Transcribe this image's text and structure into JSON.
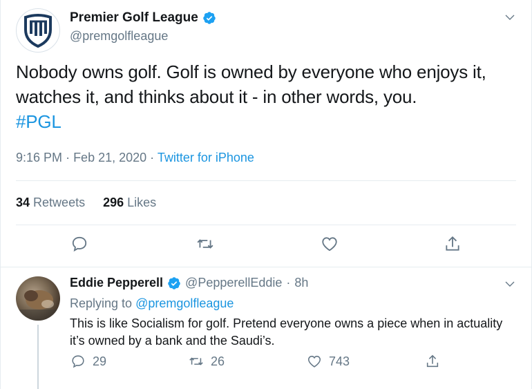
{
  "main_tweet": {
    "display_name": "Premier Golf League",
    "handle": "@premgolfleague",
    "text": "Nobody owns golf. Golf is owned by everyone who enjoys it, watches it, and thinks about it - in other words, you.",
    "hashtag": "#PGL",
    "time": "9:16 PM",
    "date": "Feb 21, 2020",
    "source": "Twitter for iPhone",
    "retweets_count": "34",
    "retweets_label": "Retweets",
    "likes_count": "296",
    "likes_label": "Likes",
    "icons": [
      "reply-icon",
      "retweet-icon",
      "like-icon",
      "share-icon",
      "chevron-down-icon",
      "verified-badge-icon"
    ]
  },
  "reply_tweet": {
    "display_name": "Eddie Pepperell",
    "handle": "@PepperellEddie",
    "separator": "·",
    "time_ago": "8h",
    "replying_prefix": "Replying to",
    "replying_to": "@premgolfleague",
    "text": "This is like Socialism for golf. Pretend everyone owns a piece when in actuality it’s owned by a bank and the Saudi’s.",
    "reply_count": "29",
    "retweet_count": "26",
    "like_count": "743"
  },
  "colors": {
    "link": "#1b95e0",
    "muted": "#657786",
    "text": "#14171a",
    "divider": "#e6ecf0",
    "logo": "#1c3a5e"
  }
}
